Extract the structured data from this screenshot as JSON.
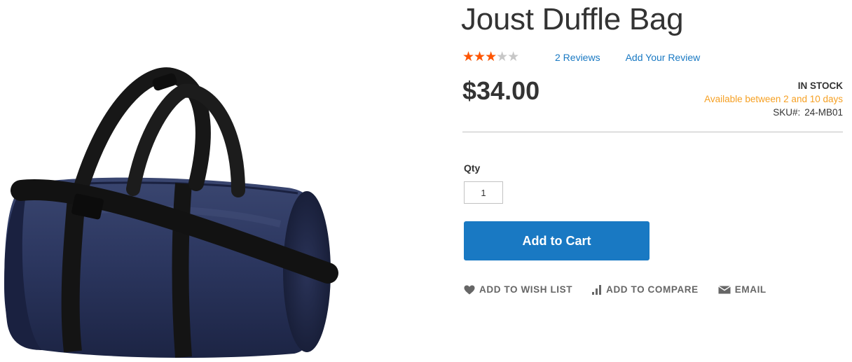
{
  "product": {
    "title": "Joust Duffle Bag",
    "image_alt": "Joust Duffle Bag product photo",
    "rating": {
      "value": 2.5,
      "max": 5,
      "stars_glyphs": "★★★★★"
    },
    "reviews_link": "2 Reviews",
    "add_review_link": "Add Your Review",
    "price": "$34.00",
    "stock_status": "In stock",
    "availability": "Available between 2 and 10 days",
    "sku_label": "SKU#:",
    "sku_value": "24-MB01",
    "qty_label": "Qty",
    "qty_value": "1",
    "add_to_cart_label": "Add to Cart"
  },
  "actions": {
    "wishlist_label": "Add to Wish List",
    "compare_label": "Add to Compare",
    "email_label": "Email",
    "wishlist_icon": "heart-icon",
    "compare_icon": "bar-chart-icon",
    "email_icon": "envelope-icon"
  },
  "colors": {
    "accent_blue": "#1979c3",
    "star_fill": "#ff5501",
    "star_empty": "#c7c7c7",
    "availability_orange": "#f6a023",
    "text_dark": "#333333",
    "text_muted": "#666666"
  }
}
